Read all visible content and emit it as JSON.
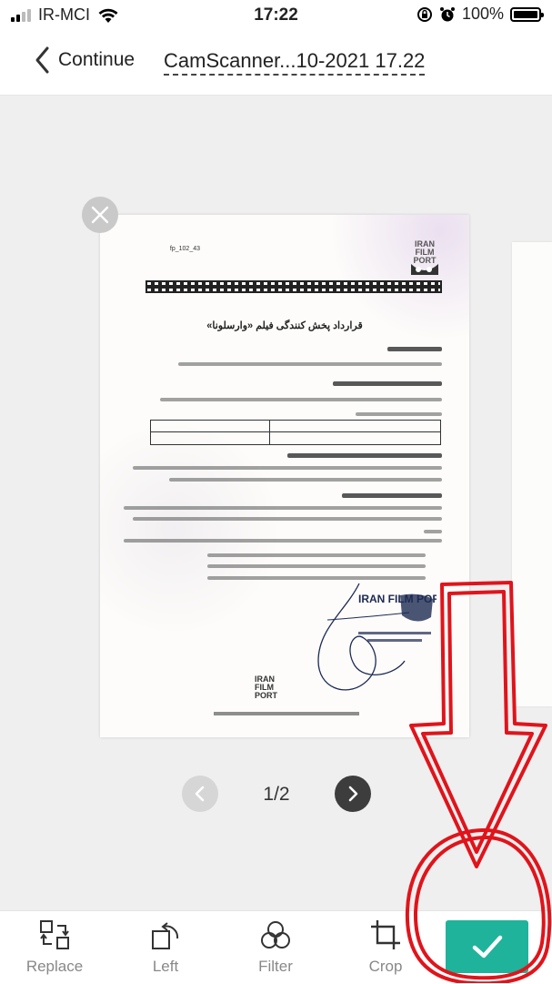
{
  "status_bar": {
    "carrier": "IR-MCI",
    "time": "17:22",
    "battery": "100%",
    "icons": [
      "signal-icon",
      "wifi-icon",
      "rotation-lock-icon",
      "alarm-icon",
      "battery-icon"
    ]
  },
  "nav": {
    "back_label": "Continue",
    "title": "CamScanner...10-2021 17.22"
  },
  "document": {
    "heading": "قرارداد پخش کنندگی فیلم «وارسلونا»",
    "logo_text": "IRAN FILM PORT",
    "stamp_text": "IRAN FILM PORT",
    "footer_logo_text": "IRAN FILM PORT",
    "header_number": "fp_102_43"
  },
  "pager": {
    "label": "1/2",
    "current": 1,
    "total": 2
  },
  "toolbar": {
    "items": [
      {
        "label": "Replace",
        "icon": "replace-icon"
      },
      {
        "label": "Left",
        "icon": "rotate-left-icon"
      },
      {
        "label": "Filter",
        "icon": "filter-icon"
      },
      {
        "label": "Crop",
        "icon": "crop-icon"
      }
    ],
    "confirm_icon": "checkmark-icon"
  },
  "colors": {
    "accent": "#1fb39b",
    "annotation": "#e0141b",
    "pager_next": "#3d3d3d",
    "pager_prev_disabled": "#d6d6d6"
  }
}
